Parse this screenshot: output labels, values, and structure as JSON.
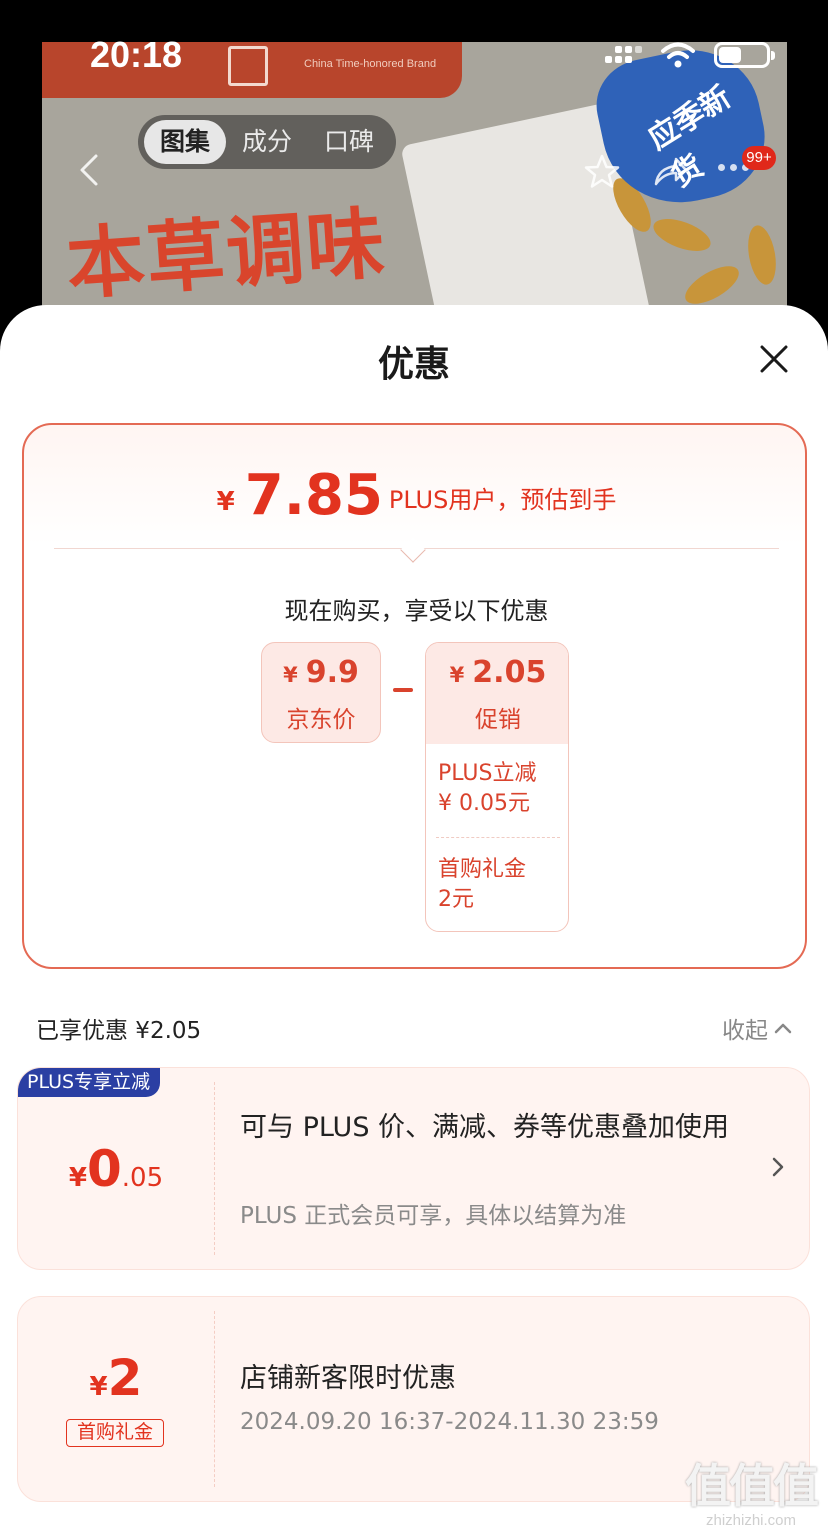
{
  "status_bar": {
    "time": "20:18"
  },
  "product_banner": {
    "brand_en": "China Time-honored Brand",
    "headline": "本草调味",
    "badge_text": "应季新货",
    "message_count": "99+"
  },
  "gallery_tabs": [
    "图集",
    "成分",
    "口碑"
  ],
  "sheet": {
    "title": "优惠",
    "estimate": {
      "yen": "¥",
      "amount": "7.85",
      "label": "PLUS用户，预估到手"
    },
    "buy_note": "现在购买，享受以下优惠",
    "jd_price": {
      "yen": "¥",
      "amount": "9.9",
      "label": "京东价"
    },
    "promo": {
      "yen": "¥",
      "amount": "2.05",
      "label": "促销",
      "items": [
        {
          "line1": "PLUS立减",
          "line2": "¥ 0.05元"
        },
        {
          "line1": "首购礼金",
          "line2": "2元"
        }
      ]
    },
    "enjoyed": "已享优惠 ¥2.05",
    "collapse": "收起",
    "coupons": [
      {
        "tag": "PLUS专享立减",
        "yen": "¥",
        "int": "0",
        "dec": ".05",
        "title": "可与 PLUS 价、满减、券等优惠叠加使用",
        "subtitle": "PLUS 正式会员可享，具体以结算为准"
      },
      {
        "yen": "¥",
        "int": "2",
        "tag": "首购礼金",
        "title": "店铺新客限时优惠",
        "subtitle": "2024.09.20 16:37-2024.11.30 23:59"
      }
    ]
  },
  "watermark": {
    "chars": "值值值",
    "url": "zhizhizhi.com"
  },
  "colors": {
    "accent": "#e2331f",
    "plus_blue": "#2b3fa3",
    "card_border": "#e46a54"
  }
}
